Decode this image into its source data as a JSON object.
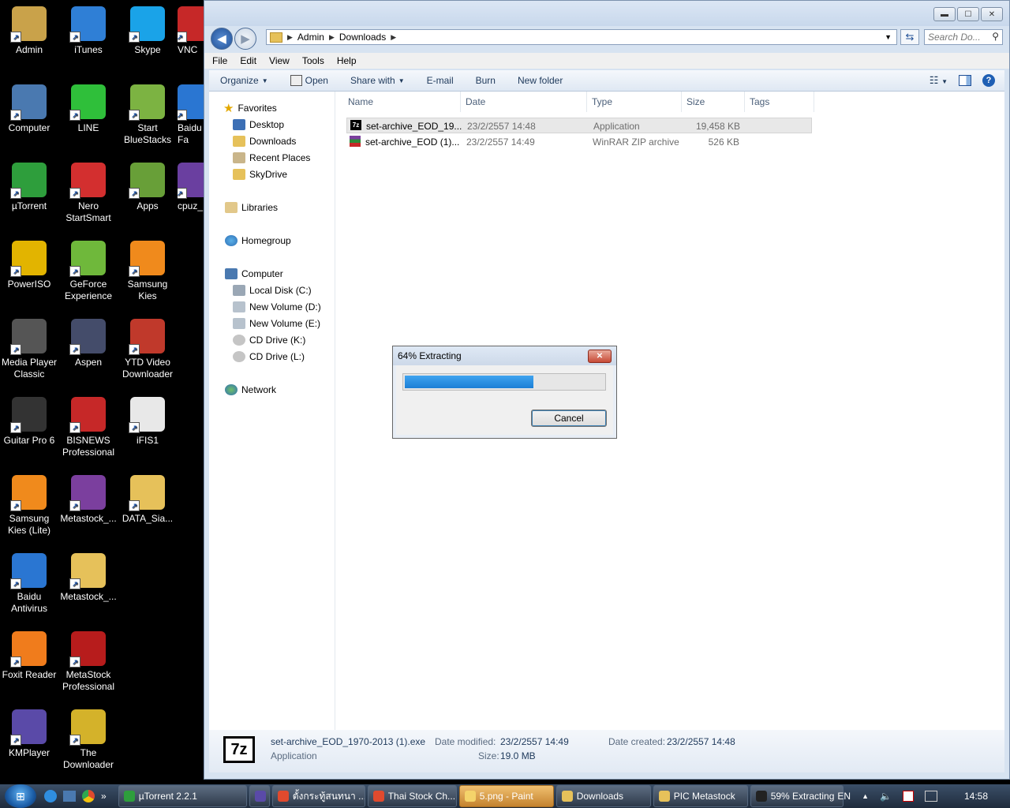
{
  "desktop_icons": [
    {
      "label": "Admin",
      "color": "#c9a24a"
    },
    {
      "label": "iTunes",
      "color": "#2f7fd6"
    },
    {
      "label": "Skype",
      "color": "#1aa3e8"
    },
    {
      "label": "VNC",
      "color": "#c62828"
    },
    {
      "label": "Computer",
      "color": "#4a79b0"
    },
    {
      "label": "LINE",
      "color": "#2fbf3a"
    },
    {
      "label": "Start BlueStacks",
      "color": "#7cb342"
    },
    {
      "label": "Baidu Fa",
      "color": "#2a76d2"
    },
    {
      "label": "µTorrent",
      "color": "#2e9e3c"
    },
    {
      "label": "Nero StartSmart",
      "color": "#d32f2f"
    },
    {
      "label": "Apps",
      "color": "#689f38"
    },
    {
      "label": "cpuz_",
      "color": "#6a3fa0"
    },
    {
      "label": "PowerISO",
      "color": "#e2b400"
    },
    {
      "label": "GeForce Experience",
      "color": "#6fb83b"
    },
    {
      "label": "Samsung Kies",
      "color": "#f08a1c"
    },
    {
      "label": "Media Player Classic",
      "color": "#555555"
    },
    {
      "label": "Aspen",
      "color": "#444c6a"
    },
    {
      "label": "YTD Video Downloader",
      "color": "#c0392b"
    },
    {
      "label": "Guitar Pro 6",
      "color": "#333333"
    },
    {
      "label": "BISNEWS Professional",
      "color": "#c62828"
    },
    {
      "label": "iFIS1",
      "color": "#e8e8e8"
    },
    {
      "label": "Samsung Kies (Lite)",
      "color": "#f08a1c"
    },
    {
      "label": "Metastock_...",
      "color": "#7b3f9e"
    },
    {
      "label": "DATA_Sia...",
      "color": "#e6c15a"
    },
    {
      "label": "Baidu Antivirus",
      "color": "#2a76d2"
    },
    {
      "label": "Metastock_...",
      "color": "#e6c15a"
    },
    {
      "label": "Foxit Reader",
      "color": "#f07c1c"
    },
    {
      "label": "MetaStock Professional",
      "color": "#b71c1c"
    },
    {
      "label": "KMPlayer",
      "color": "#5a4aa8"
    },
    {
      "label": "The Downloader",
      "color": "#d4b22a"
    }
  ],
  "explorer": {
    "window_controls": {
      "minimize": "▬",
      "maximize": "☐",
      "close": "✕"
    },
    "nav": {
      "back": "◀",
      "forward": "▶"
    },
    "breadcrumb": [
      "Admin",
      "Downloads"
    ],
    "search_placeholder": "Search Do...",
    "menu": [
      "File",
      "Edit",
      "View",
      "Tools",
      "Help"
    ],
    "toolbar": {
      "organize": "Organize",
      "open": "Open",
      "share_with": "Share with",
      "email": "E-mail",
      "burn": "Burn",
      "new_folder": "New folder",
      "help": "?"
    },
    "navpane": {
      "favorites": "Favorites",
      "desktop": "Desktop",
      "downloads": "Downloads",
      "recent": "Recent Places",
      "skydrive": "SkyDrive",
      "libraries": "Libraries",
      "homegroup": "Homegroup",
      "computer": "Computer",
      "local_c": "Local Disk (C:)",
      "vol_d": "New Volume (D:)",
      "vol_e": "New Volume (E:)",
      "cd_k": "CD Drive (K:)",
      "cd_l": "CD Drive (L:)",
      "network": "Network"
    },
    "columns": {
      "name": "Name",
      "date": "Date",
      "type": "Type",
      "size": "Size",
      "tags": "Tags"
    },
    "files": [
      {
        "name": "set-archive_EOD_19...",
        "date": "23/2/2557 14:48",
        "type": "Application",
        "size": "19,458 KB",
        "icon": "7z-icon",
        "selected": true
      },
      {
        "name": "set-archive_EOD (1)...",
        "date": "23/2/2557 14:49",
        "type": "WinRAR ZIP archive",
        "size": "526 KB",
        "icon": "winrar-icon",
        "selected": false
      }
    ],
    "details": {
      "filename": "set-archive_EOD_1970-2013 (1).exe",
      "filetype": "Application",
      "date_modified_label": "Date modified:",
      "date_modified": "23/2/2557 14:49",
      "size_label": "Size:",
      "size": "19.0 MB",
      "date_created_label": "Date created:",
      "date_created": "23/2/2557 14:48",
      "icon_text": "7z"
    }
  },
  "dialog": {
    "title": "64% Extracting",
    "progress": 0.64,
    "cancel": "Cancel"
  },
  "taskbar": {
    "tasks": [
      {
        "label": "µTorrent 2.2.1",
        "color": "#2e9e3c"
      },
      {
        "label": "",
        "color": "#5a4aa8"
      },
      {
        "label": "ตั้งกระทู้สนทนา ...",
        "color": "#e04a2e"
      },
      {
        "label": "Thai Stock Ch...",
        "color": "#e04a2e"
      },
      {
        "label": "5.png - Paint",
        "color": "#f4d36a"
      },
      {
        "label": "Downloads",
        "color": "#e6c15a"
      },
      {
        "label": "PIC Metastock",
        "color": "#e6c15a"
      },
      {
        "label": "59% Extracting",
        "color": "#222222"
      }
    ],
    "lang": "EN",
    "clock": "14:58"
  }
}
